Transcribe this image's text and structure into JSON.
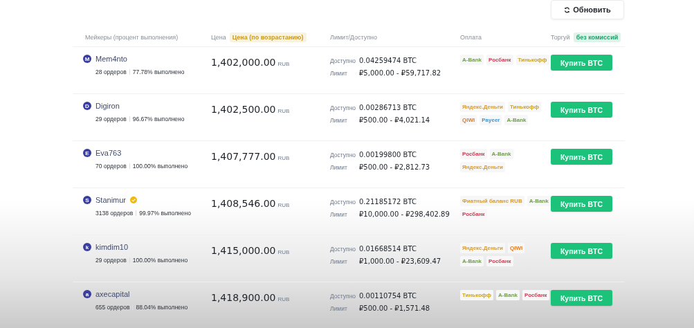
{
  "refresh_button": {
    "label": "Обновить"
  },
  "table": {
    "columns": [
      {
        "label": "Мейкеры (процент выполнения)"
      },
      {
        "label": "Цена",
        "badge": {
          "label": "Цена (по возрастанию)",
          "color": "#c99a1e"
        }
      },
      {
        "label": "Лимит/Доступно"
      },
      {
        "label": "Оплата"
      },
      {
        "label": "Торгуй",
        "badge": {
          "label": "без комиссий",
          "color": "#1aa36a"
        }
      }
    ],
    "rows": [
      {
        "avatar": "M",
        "name": "Mem4nto",
        "verified": false,
        "orders": "28 ордеров",
        "completion": "77.78% выполнено",
        "price": "1,402,000.00",
        "currency": "RUB",
        "available_label": "Доступно",
        "available": "0.04259474 BTC",
        "limit_label": "Лимит",
        "limit": "₽5,000.00 - ₽59,717.82",
        "payments": [
          {
            "name": "A-Bank",
            "color": "#6f9e4c"
          },
          {
            "name": "Росбанк",
            "color": "#cc3d55"
          },
          {
            "name": "Тинькофф",
            "color": "#c9a227"
          }
        ],
        "action": "Купить BTC"
      },
      {
        "avatar": "D",
        "name": "Digiron",
        "verified": false,
        "orders": "29 ордеров",
        "completion": "96.67% выполнено",
        "price": "1,402,500.00",
        "currency": "RUB",
        "available_label": "Доступно",
        "available": "0.00286713 BTC",
        "limit_label": "Лимит",
        "limit": "₽500.00 - ₽4,021.14",
        "payments": [
          {
            "name": "Яндекс.Деньги",
            "color": "#d49b36"
          },
          {
            "name": "Тинькофф",
            "color": "#c9a227"
          },
          {
            "name": "QIWI",
            "color": "#e07a1f"
          },
          {
            "name": "Payeer",
            "color": "#3a98d8"
          },
          {
            "name": "A-Bank",
            "color": "#6f9e4c"
          }
        ],
        "action": "Купить BTC"
      },
      {
        "avatar": "E",
        "name": "Eva763",
        "verified": false,
        "orders": "70 ордеров",
        "completion": "100.00% выполнено",
        "price": "1,407,777.00",
        "currency": "RUB",
        "available_label": "Доступно",
        "available": "0.00199800 BTC",
        "limit_label": "Лимит",
        "limit": "₽500.00 - ₽2,812.73",
        "payments": [
          {
            "name": "Росбанк",
            "color": "#cc3d55"
          },
          {
            "name": "A-Bank",
            "color": "#6f9e4c"
          },
          {
            "name": "Яндекс.Деньги",
            "color": "#d49b36"
          }
        ],
        "action": "Купить BTC"
      },
      {
        "avatar": "S",
        "name": "Stanimur",
        "verified": true,
        "orders": "3138 ордеров",
        "completion": "99.97% выполнено",
        "price": "1,408,546.00",
        "currency": "RUB",
        "available_label": "Доступно",
        "available": "0.21185172 BTC",
        "limit_label": "Лимит",
        "limit": "₽10,000.00 - ₽298,402.89",
        "payments": [
          {
            "name": "Фиатный баланс RUB",
            "color": "#d49b36"
          },
          {
            "name": "A-Bank",
            "color": "#6f9e4c"
          },
          {
            "name": "Росбанк",
            "color": "#cc3d55"
          }
        ],
        "action": "Купить BTC"
      },
      {
        "avatar": "k",
        "name": "kimdim10",
        "verified": false,
        "orders": "29 ордеров",
        "completion": "100.00% выполнено",
        "price": "1,415,000.00",
        "currency": "RUB",
        "available_label": "Доступно",
        "available": "0.01668514 BTC",
        "limit_label": "Лимит",
        "limit": "₽1,000.00 - ₽23,609.47",
        "payments": [
          {
            "name": "Яндекс.Деньги",
            "color": "#d49b36"
          },
          {
            "name": "QIWI",
            "color": "#e07a1f"
          },
          {
            "name": "A-Bank",
            "color": "#6f9e4c"
          },
          {
            "name": "Росбанк",
            "color": "#cc3d55"
          }
        ],
        "action": "Купить BTC"
      },
      {
        "avatar": "a",
        "name": "axecapital",
        "verified": false,
        "orders": "655 ордеров",
        "completion": "88.04% выполнено",
        "price": "1,418,900.00",
        "currency": "RUB",
        "available_label": "Доступно",
        "available": "0.00110754 BTC",
        "limit_label": "Лимит",
        "limit": "₽500.00 - ₽1,571.48",
        "payments": [
          {
            "name": "Тинькофф",
            "color": "#c9a227"
          },
          {
            "name": "A-Bank",
            "color": "#6f9e4c"
          },
          {
            "name": "Росбанк",
            "color": "#cc3d55"
          }
        ],
        "action": "Купить BTC"
      }
    ]
  }
}
